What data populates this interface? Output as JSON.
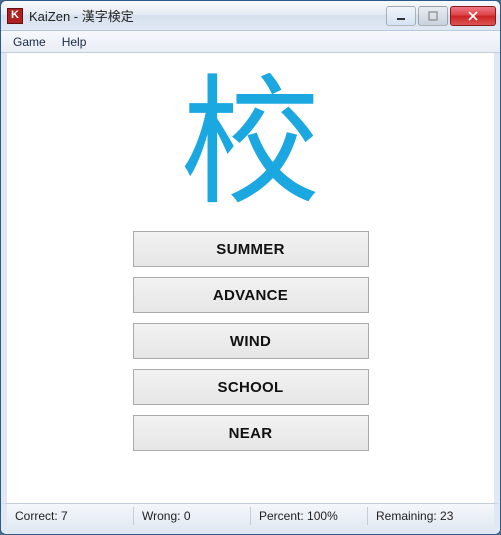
{
  "window": {
    "title": "KaiZen - 漢字検定"
  },
  "menu": {
    "game": "Game",
    "help": "Help"
  },
  "kanji": "校",
  "options": [
    "SUMMER",
    "ADVANCE",
    "WIND",
    "SCHOOL",
    "NEAR"
  ],
  "status": {
    "correct_label": "Correct:",
    "correct_value": "7",
    "wrong_label": "Wrong:",
    "wrong_value": "0",
    "percent_label": "Percent:",
    "percent_value": "100%",
    "remaining_label": "Remaining:",
    "remaining_value": "23"
  }
}
